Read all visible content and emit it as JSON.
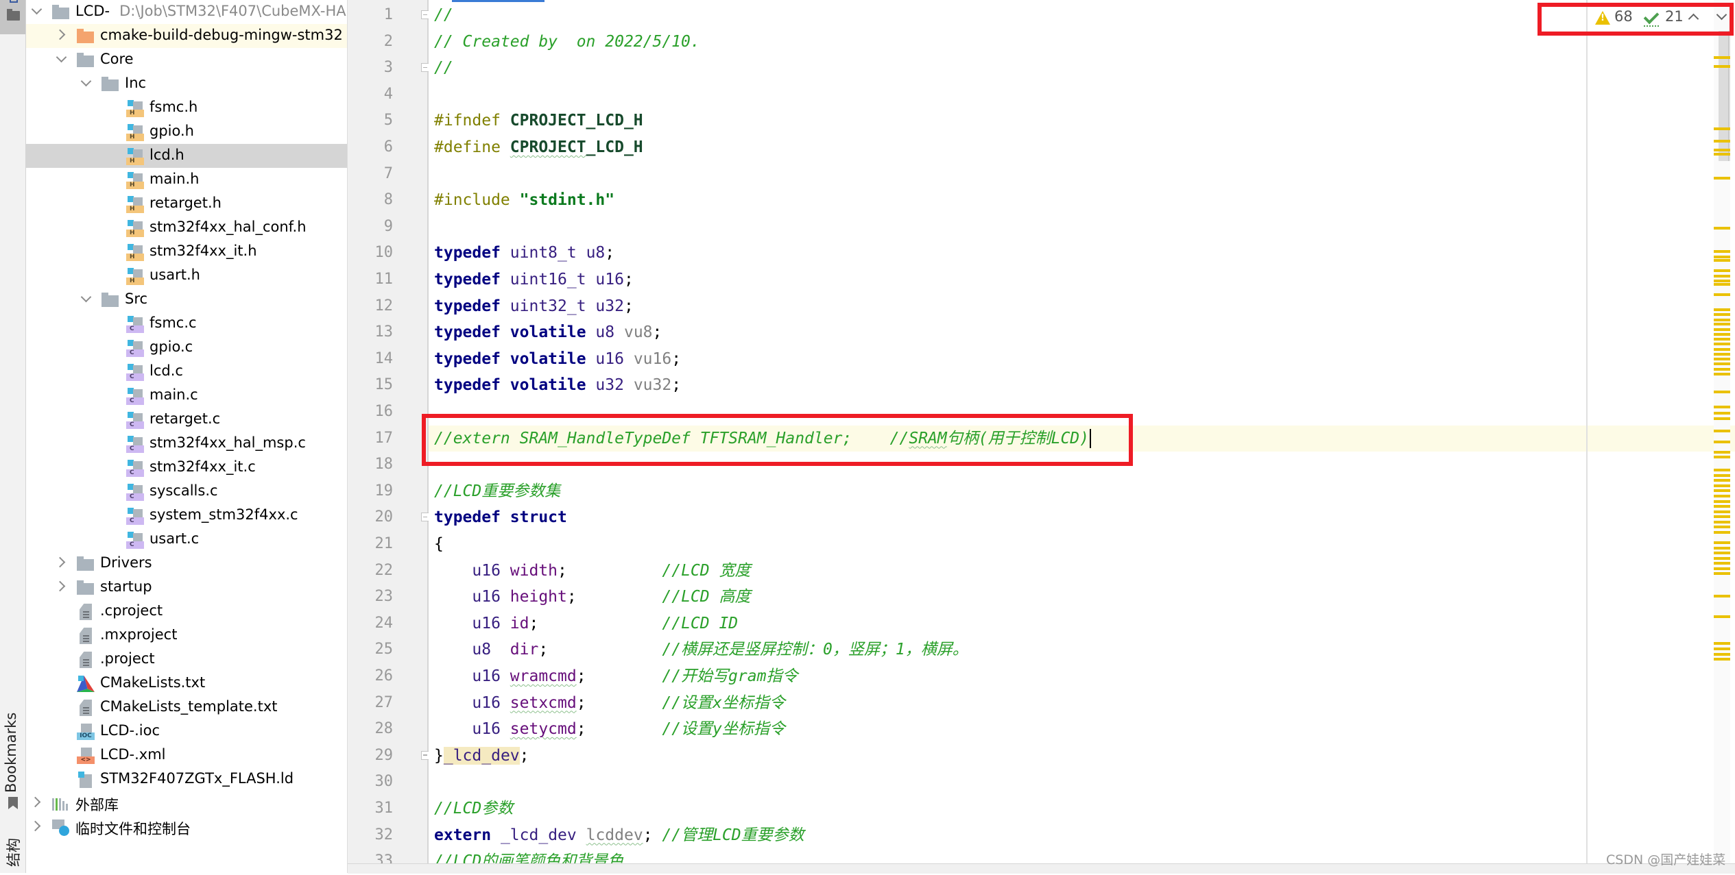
{
  "toolstrip": {
    "project_button": "project-tool-window",
    "bookmarks_label": "Bookmarks",
    "structure_label": "结构"
  },
  "project_tree": [
    {
      "depth": 0,
      "expander": "down",
      "icon": "folder",
      "label": "LCD-",
      "path": "D:\\Job\\STM32\\F407\\CubeMX-HA"
    },
    {
      "depth": 1,
      "expander": "right",
      "icon": "folder-orange",
      "label": "cmake-build-debug-mingw-stm32",
      "highlight": true
    },
    {
      "depth": 1,
      "expander": "down",
      "icon": "folder",
      "label": "Core"
    },
    {
      "depth": 2,
      "expander": "down",
      "icon": "folder",
      "label": "Inc"
    },
    {
      "depth": 3,
      "icon": "h-file",
      "label": "fsmc.h"
    },
    {
      "depth": 3,
      "icon": "h-file",
      "label": "gpio.h"
    },
    {
      "depth": 3,
      "icon": "h-file",
      "label": "lcd.h",
      "selected": true
    },
    {
      "depth": 3,
      "icon": "h-file",
      "label": "main.h"
    },
    {
      "depth": 3,
      "icon": "h-file",
      "label": "retarget.h"
    },
    {
      "depth": 3,
      "icon": "h-file",
      "label": "stm32f4xx_hal_conf.h"
    },
    {
      "depth": 3,
      "icon": "h-file",
      "label": "stm32f4xx_it.h"
    },
    {
      "depth": 3,
      "icon": "h-file",
      "label": "usart.h"
    },
    {
      "depth": 2,
      "expander": "down",
      "icon": "folder",
      "label": "Src"
    },
    {
      "depth": 3,
      "icon": "c-file",
      "label": "fsmc.c"
    },
    {
      "depth": 3,
      "icon": "c-file",
      "label": "gpio.c"
    },
    {
      "depth": 3,
      "icon": "c-file",
      "label": "lcd.c"
    },
    {
      "depth": 3,
      "icon": "c-file",
      "label": "main.c"
    },
    {
      "depth": 3,
      "icon": "c-file",
      "label": "retarget.c"
    },
    {
      "depth": 3,
      "icon": "c-file",
      "label": "stm32f4xx_hal_msp.c"
    },
    {
      "depth": 3,
      "icon": "c-file",
      "label": "stm32f4xx_it.c"
    },
    {
      "depth": 3,
      "icon": "c-file",
      "label": "syscalls.c"
    },
    {
      "depth": 3,
      "icon": "c-file",
      "label": "system_stm32f4xx.c"
    },
    {
      "depth": 3,
      "icon": "c-file",
      "label": "usart.c"
    },
    {
      "depth": 1,
      "expander": "right",
      "icon": "folder",
      "label": "Drivers"
    },
    {
      "depth": 1,
      "expander": "right",
      "icon": "folder",
      "label": "startup"
    },
    {
      "depth": 1,
      "icon": "text-file",
      "label": ".cproject"
    },
    {
      "depth": 1,
      "icon": "text-file",
      "label": ".mxproject"
    },
    {
      "depth": 1,
      "icon": "text-file",
      "label": ".project"
    },
    {
      "depth": 1,
      "icon": "cmake-file",
      "label": "CMakeLists.txt"
    },
    {
      "depth": 1,
      "icon": "text-file",
      "label": "CMakeLists_template.txt"
    },
    {
      "depth": 1,
      "icon": "ioc-file",
      "label": "LCD-.ioc"
    },
    {
      "depth": 1,
      "icon": "xml-file",
      "label": "LCD-.xml"
    },
    {
      "depth": 1,
      "icon": "ld-file",
      "label": "STM32F407ZGTx_FLASH.ld"
    },
    {
      "depth": 0,
      "expander": "right",
      "icon": "library",
      "label": "外部库"
    },
    {
      "depth": 0,
      "expander": "right",
      "icon": "scratches",
      "label": "临时文件和控制台"
    }
  ],
  "editor": {
    "current_line": 17,
    "inspections": {
      "warnings": "68",
      "typos": "21"
    },
    "lines": [
      {
        "n": 1,
        "fold": "start",
        "tokens": [
          [
            "com",
            "//"
          ]
        ]
      },
      {
        "n": 2,
        "tokens": [
          [
            "com",
            "// Created by  on 2022/5/10."
          ]
        ]
      },
      {
        "n": 3,
        "fold": "end",
        "tokens": [
          [
            "com",
            "//"
          ]
        ]
      },
      {
        "n": 4,
        "tokens": []
      },
      {
        "n": 5,
        "tokens": [
          [
            "pp",
            "#ifndef "
          ],
          [
            "macro",
            "CPROJECT_LCD_H"
          ]
        ]
      },
      {
        "n": 6,
        "tokens": [
          [
            "pp",
            "#define "
          ],
          [
            "macro squig",
            "CPROJECT"
          ],
          [
            "macro",
            "_LCD_H"
          ]
        ]
      },
      {
        "n": 7,
        "tokens": []
      },
      {
        "n": 8,
        "tokens": [
          [
            "pp",
            "#include "
          ],
          [
            "str",
            "\"stdint.h\""
          ]
        ]
      },
      {
        "n": 9,
        "tokens": []
      },
      {
        "n": 10,
        "tokens": [
          [
            "kw",
            "typedef"
          ],
          [
            "plain",
            " "
          ],
          [
            "type",
            "uint8_t u8"
          ],
          [
            "plain",
            ";"
          ]
        ]
      },
      {
        "n": 11,
        "tokens": [
          [
            "kw",
            "typedef"
          ],
          [
            "plain",
            " "
          ],
          [
            "type",
            "uint16_t u16"
          ],
          [
            "plain",
            ";"
          ]
        ]
      },
      {
        "n": 12,
        "tokens": [
          [
            "kw",
            "typedef"
          ],
          [
            "plain",
            " "
          ],
          [
            "type",
            "uint32_t u32"
          ],
          [
            "plain",
            ";"
          ]
        ]
      },
      {
        "n": 13,
        "tokens": [
          [
            "kw",
            "typedef volatile"
          ],
          [
            "plain",
            " "
          ],
          [
            "type",
            "u8"
          ],
          [
            "plain",
            " "
          ],
          [
            "ident",
            "vu8"
          ],
          [
            "plain",
            ";"
          ]
        ]
      },
      {
        "n": 14,
        "tokens": [
          [
            "kw",
            "typedef volatile"
          ],
          [
            "plain",
            " "
          ],
          [
            "type",
            "u16"
          ],
          [
            "plain",
            " "
          ],
          [
            "ident",
            "vu16"
          ],
          [
            "plain",
            ";"
          ]
        ]
      },
      {
        "n": 15,
        "tokens": [
          [
            "kw",
            "typedef volatile"
          ],
          [
            "plain",
            " "
          ],
          [
            "type",
            "u32"
          ],
          [
            "plain",
            " "
          ],
          [
            "ident",
            "vu32"
          ],
          [
            "plain",
            ";"
          ]
        ]
      },
      {
        "n": 16,
        "tokens": []
      },
      {
        "n": 17,
        "caret": true,
        "tokens": [
          [
            "com",
            "//extern SRAM_HandleTypeDef TFTSRAM_Handler;    //"
          ],
          [
            "com squig",
            "SRAM"
          ],
          [
            "com",
            "句柄(用于控制LCD)"
          ]
        ]
      },
      {
        "n": 18,
        "tokens": []
      },
      {
        "n": 19,
        "tokens": [
          [
            "com",
            "//LCD重要参数集"
          ]
        ]
      },
      {
        "n": 20,
        "fold": "start",
        "tokens": [
          [
            "kw",
            "typedef struct"
          ]
        ]
      },
      {
        "n": 21,
        "tokens": [
          [
            "plain",
            "{"
          ]
        ]
      },
      {
        "n": 22,
        "tokens": [
          [
            "plain",
            "    "
          ],
          [
            "type",
            "u16"
          ],
          [
            "plain",
            " "
          ],
          [
            "field",
            "width"
          ],
          [
            "plain",
            ";          "
          ],
          [
            "com",
            "//LCD 宽度"
          ]
        ]
      },
      {
        "n": 23,
        "tokens": [
          [
            "plain",
            "    "
          ],
          [
            "type",
            "u16"
          ],
          [
            "plain",
            " "
          ],
          [
            "field",
            "height"
          ],
          [
            "plain",
            ";         "
          ],
          [
            "com",
            "//LCD 高度"
          ]
        ]
      },
      {
        "n": 24,
        "tokens": [
          [
            "plain",
            "    "
          ],
          [
            "type",
            "u16"
          ],
          [
            "plain",
            " "
          ],
          [
            "field",
            "id"
          ],
          [
            "plain",
            ";             "
          ],
          [
            "com",
            "//LCD ID"
          ]
        ]
      },
      {
        "n": 25,
        "tokens": [
          [
            "plain",
            "    "
          ],
          [
            "type",
            "u8"
          ],
          [
            "plain",
            "  "
          ],
          [
            "field",
            "dir"
          ],
          [
            "plain",
            ";            "
          ],
          [
            "com",
            "//横屏还是竖屏控制：0，竖屏；1，横屏。"
          ]
        ]
      },
      {
        "n": 26,
        "tokens": [
          [
            "plain",
            "    "
          ],
          [
            "type",
            "u16"
          ],
          [
            "plain",
            " "
          ],
          [
            "field squig",
            "wramcmd"
          ],
          [
            "plain",
            ";        "
          ],
          [
            "com",
            "//开始写gram指令"
          ]
        ]
      },
      {
        "n": 27,
        "tokens": [
          [
            "plain",
            "    "
          ],
          [
            "type",
            "u16"
          ],
          [
            "plain",
            " "
          ],
          [
            "field squig",
            "setxcmd"
          ],
          [
            "plain",
            ";        "
          ],
          [
            "com",
            "//设置x坐标指令"
          ]
        ]
      },
      {
        "n": 28,
        "tokens": [
          [
            "plain",
            "    "
          ],
          [
            "type",
            "u16"
          ],
          [
            "plain",
            " "
          ],
          [
            "field squig",
            "setycmd"
          ],
          [
            "plain",
            ";        "
          ],
          [
            "com",
            "//设置y坐标指令"
          ]
        ]
      },
      {
        "n": 29,
        "fold": "end",
        "tokens": [
          [
            "plain",
            "}"
          ],
          [
            "hlid",
            "_lcd_dev"
          ],
          [
            "plain",
            ";"
          ]
        ]
      },
      {
        "n": 30,
        "tokens": []
      },
      {
        "n": 31,
        "tokens": [
          [
            "com",
            "//LCD参数"
          ]
        ]
      },
      {
        "n": 32,
        "tokens": [
          [
            "kw",
            "extern"
          ],
          [
            "plain",
            " "
          ],
          [
            "type",
            "_lcd_dev"
          ],
          [
            "plain",
            " "
          ],
          [
            "ident squig",
            "lcddev"
          ],
          [
            "plain",
            "; "
          ],
          [
            "com",
            "//管理LCD重要参数"
          ]
        ]
      },
      {
        "n": 33,
        "tokens": [
          [
            "com",
            "//LCD的画笔颜色和背景色"
          ]
        ]
      }
    ]
  },
  "error_stripe_marks": [
    0.065,
    0.075,
    0.148,
    0.162,
    0.172,
    0.177,
    0.205,
    0.263,
    0.29,
    0.296,
    0.3,
    0.312,
    0.318,
    0.324,
    0.328,
    0.34,
    0.357,
    0.363,
    0.369,
    0.374,
    0.38,
    0.386,
    0.391,
    0.397,
    0.403,
    0.409,
    0.414,
    0.42,
    0.426,
    0.432,
    0.452,
    0.47,
    0.477,
    0.483,
    0.498,
    0.51,
    0.522,
    0.528,
    0.543,
    0.549,
    0.555,
    0.561,
    0.567,
    0.573,
    0.579,
    0.585,
    0.591,
    0.597,
    0.603,
    0.609,
    0.615,
    0.627,
    0.633,
    0.639,
    0.645,
    0.651,
    0.657,
    0.663,
    0.689,
    0.713,
    0.744,
    0.75,
    0.756,
    0.762
  ],
  "watermark": "CSDN @国产娃娃菜"
}
